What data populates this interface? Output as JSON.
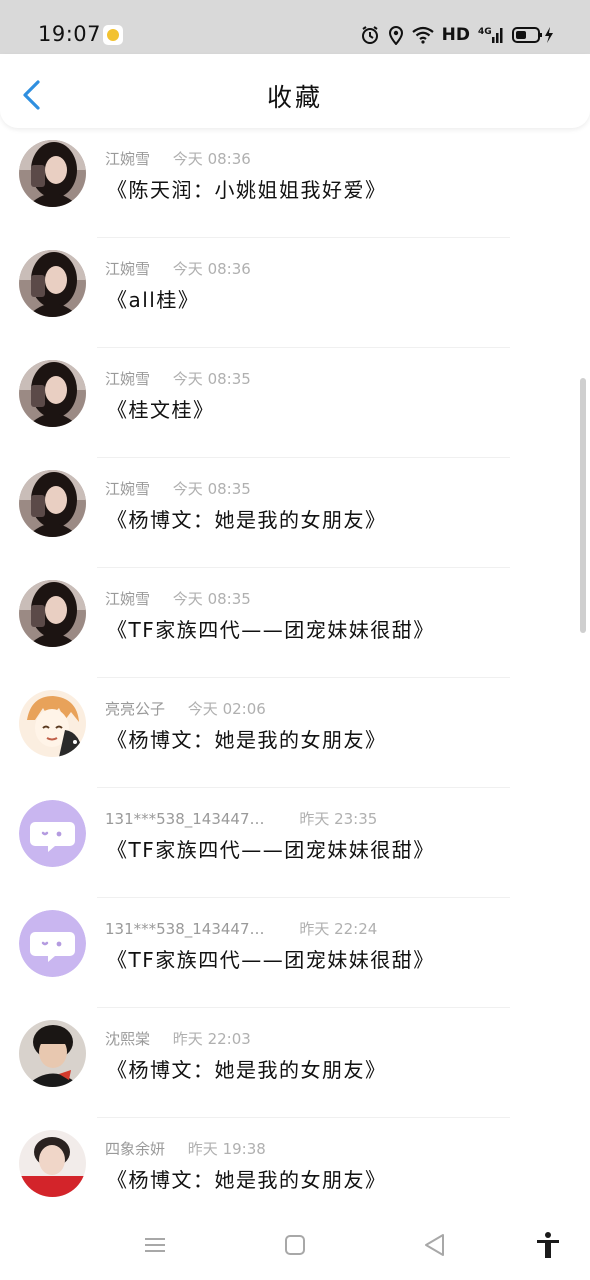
{
  "status_bar": {
    "time": "19:07",
    "network_hd": "HD",
    "network_4g": "4G"
  },
  "header": {
    "title": "收藏",
    "back_icon": "chevron-left-icon"
  },
  "colors": {
    "accent": "#2f8fe0",
    "status_bar_bg": "#d9d9d9",
    "purple_avatar": "#c9b6f0"
  },
  "favorites": [
    {
      "sender": "江婉雪",
      "time": "今天 08:36",
      "title": "《陈天润：小姚姐姐我好爱》",
      "avatar": "girl-photo"
    },
    {
      "sender": "江婉雪",
      "time": "今天 08:36",
      "title": "《all桂》",
      "avatar": "girl-photo"
    },
    {
      "sender": "江婉雪",
      "time": "今天 08:35",
      "title": "《桂文桂》",
      "avatar": "girl-photo"
    },
    {
      "sender": "江婉雪",
      "time": "今天 08:35",
      "title": "《杨博文：她是我的女朋友》",
      "avatar": "girl-photo"
    },
    {
      "sender": "江婉雪",
      "time": "今天 08:35",
      "title": "《TF家族四代——团宠妹妹很甜》",
      "avatar": "girl-photo"
    },
    {
      "sender": "亮亮公子",
      "time": "今天 02:06",
      "title": "《杨博文：她是我的女朋友》",
      "avatar": "anime-boy"
    },
    {
      "sender": "131***538_143447…",
      "time": "昨天 23:35",
      "title": "《TF家族四代——团宠妹妹很甜》",
      "avatar": "chat-bubble"
    },
    {
      "sender": "131***538_143447…",
      "time": "昨天 22:24",
      "title": "《TF家族四代——团宠妹妹很甜》",
      "avatar": "chat-bubble"
    },
    {
      "sender": "沈熙棠",
      "time": "昨天 22:03",
      "title": "《杨博文：她是我的女朋友》",
      "avatar": "boy-photo"
    },
    {
      "sender": "四象余妍",
      "time": "昨天 19:38",
      "title": "《杨博文：她是我的女朋友》",
      "avatar": "boy-red"
    }
  ],
  "bottom_nav": {
    "menu_icon": "menu-icon",
    "home_icon": "home-square-icon",
    "back_icon": "back-triangle-icon",
    "accessibility_icon": "accessibility-icon"
  }
}
